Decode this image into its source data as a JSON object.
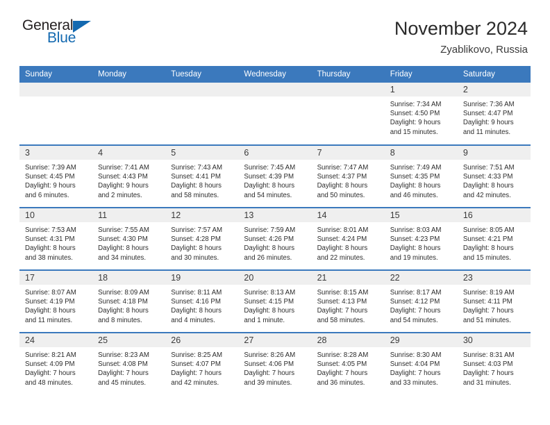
{
  "brand": {
    "name_dark": "General",
    "name_blue": "Blue",
    "accent_color": "#1369b0"
  },
  "header": {
    "title": "November 2024",
    "location": "Zyablikovo, Russia",
    "header_bg_color": "#3b79bd",
    "daynum_bg_color": "#efefef"
  },
  "weekday_headers": [
    "Sunday",
    "Monday",
    "Tuesday",
    "Wednesday",
    "Thursday",
    "Friday",
    "Saturday"
  ],
  "labels": {
    "sunrise_prefix": "Sunrise:",
    "sunset_prefix": "Sunset:",
    "daylight_prefix": "Daylight:"
  },
  "weeks": [
    [
      {
        "day": "",
        "lines": []
      },
      {
        "day": "",
        "lines": []
      },
      {
        "day": "",
        "lines": []
      },
      {
        "day": "",
        "lines": []
      },
      {
        "day": "",
        "lines": []
      },
      {
        "day": "1",
        "lines": [
          "Sunrise: 7:34 AM",
          "Sunset: 4:50 PM",
          "Daylight: 9 hours",
          "and 15 minutes."
        ]
      },
      {
        "day": "2",
        "lines": [
          "Sunrise: 7:36 AM",
          "Sunset: 4:47 PM",
          "Daylight: 9 hours",
          "and 11 minutes."
        ]
      }
    ],
    [
      {
        "day": "3",
        "lines": [
          "Sunrise: 7:39 AM",
          "Sunset: 4:45 PM",
          "Daylight: 9 hours",
          "and 6 minutes."
        ]
      },
      {
        "day": "4",
        "lines": [
          "Sunrise: 7:41 AM",
          "Sunset: 4:43 PM",
          "Daylight: 9 hours",
          "and 2 minutes."
        ]
      },
      {
        "day": "5",
        "lines": [
          "Sunrise: 7:43 AM",
          "Sunset: 4:41 PM",
          "Daylight: 8 hours",
          "and 58 minutes."
        ]
      },
      {
        "day": "6",
        "lines": [
          "Sunrise: 7:45 AM",
          "Sunset: 4:39 PM",
          "Daylight: 8 hours",
          "and 54 minutes."
        ]
      },
      {
        "day": "7",
        "lines": [
          "Sunrise: 7:47 AM",
          "Sunset: 4:37 PM",
          "Daylight: 8 hours",
          "and 50 minutes."
        ]
      },
      {
        "day": "8",
        "lines": [
          "Sunrise: 7:49 AM",
          "Sunset: 4:35 PM",
          "Daylight: 8 hours",
          "and 46 minutes."
        ]
      },
      {
        "day": "9",
        "lines": [
          "Sunrise: 7:51 AM",
          "Sunset: 4:33 PM",
          "Daylight: 8 hours",
          "and 42 minutes."
        ]
      }
    ],
    [
      {
        "day": "10",
        "lines": [
          "Sunrise: 7:53 AM",
          "Sunset: 4:31 PM",
          "Daylight: 8 hours",
          "and 38 minutes."
        ]
      },
      {
        "day": "11",
        "lines": [
          "Sunrise: 7:55 AM",
          "Sunset: 4:30 PM",
          "Daylight: 8 hours",
          "and 34 minutes."
        ]
      },
      {
        "day": "12",
        "lines": [
          "Sunrise: 7:57 AM",
          "Sunset: 4:28 PM",
          "Daylight: 8 hours",
          "and 30 minutes."
        ]
      },
      {
        "day": "13",
        "lines": [
          "Sunrise: 7:59 AM",
          "Sunset: 4:26 PM",
          "Daylight: 8 hours",
          "and 26 minutes."
        ]
      },
      {
        "day": "14",
        "lines": [
          "Sunrise: 8:01 AM",
          "Sunset: 4:24 PM",
          "Daylight: 8 hours",
          "and 22 minutes."
        ]
      },
      {
        "day": "15",
        "lines": [
          "Sunrise: 8:03 AM",
          "Sunset: 4:23 PM",
          "Daylight: 8 hours",
          "and 19 minutes."
        ]
      },
      {
        "day": "16",
        "lines": [
          "Sunrise: 8:05 AM",
          "Sunset: 4:21 PM",
          "Daylight: 8 hours",
          "and 15 minutes."
        ]
      }
    ],
    [
      {
        "day": "17",
        "lines": [
          "Sunrise: 8:07 AM",
          "Sunset: 4:19 PM",
          "Daylight: 8 hours",
          "and 11 minutes."
        ]
      },
      {
        "day": "18",
        "lines": [
          "Sunrise: 8:09 AM",
          "Sunset: 4:18 PM",
          "Daylight: 8 hours",
          "and 8 minutes."
        ]
      },
      {
        "day": "19",
        "lines": [
          "Sunrise: 8:11 AM",
          "Sunset: 4:16 PM",
          "Daylight: 8 hours",
          "and 4 minutes."
        ]
      },
      {
        "day": "20",
        "lines": [
          "Sunrise: 8:13 AM",
          "Sunset: 4:15 PM",
          "Daylight: 8 hours",
          "and 1 minute."
        ]
      },
      {
        "day": "21",
        "lines": [
          "Sunrise: 8:15 AM",
          "Sunset: 4:13 PM",
          "Daylight: 7 hours",
          "and 58 minutes."
        ]
      },
      {
        "day": "22",
        "lines": [
          "Sunrise: 8:17 AM",
          "Sunset: 4:12 PM",
          "Daylight: 7 hours",
          "and 54 minutes."
        ]
      },
      {
        "day": "23",
        "lines": [
          "Sunrise: 8:19 AM",
          "Sunset: 4:11 PM",
          "Daylight: 7 hours",
          "and 51 minutes."
        ]
      }
    ],
    [
      {
        "day": "24",
        "lines": [
          "Sunrise: 8:21 AM",
          "Sunset: 4:09 PM",
          "Daylight: 7 hours",
          "and 48 minutes."
        ]
      },
      {
        "day": "25",
        "lines": [
          "Sunrise: 8:23 AM",
          "Sunset: 4:08 PM",
          "Daylight: 7 hours",
          "and 45 minutes."
        ]
      },
      {
        "day": "26",
        "lines": [
          "Sunrise: 8:25 AM",
          "Sunset: 4:07 PM",
          "Daylight: 7 hours",
          "and 42 minutes."
        ]
      },
      {
        "day": "27",
        "lines": [
          "Sunrise: 8:26 AM",
          "Sunset: 4:06 PM",
          "Daylight: 7 hours",
          "and 39 minutes."
        ]
      },
      {
        "day": "28",
        "lines": [
          "Sunrise: 8:28 AM",
          "Sunset: 4:05 PM",
          "Daylight: 7 hours",
          "and 36 minutes."
        ]
      },
      {
        "day": "29",
        "lines": [
          "Sunrise: 8:30 AM",
          "Sunset: 4:04 PM",
          "Daylight: 7 hours",
          "and 33 minutes."
        ]
      },
      {
        "day": "30",
        "lines": [
          "Sunrise: 8:31 AM",
          "Sunset: 4:03 PM",
          "Daylight: 7 hours",
          "and 31 minutes."
        ]
      }
    ]
  ]
}
